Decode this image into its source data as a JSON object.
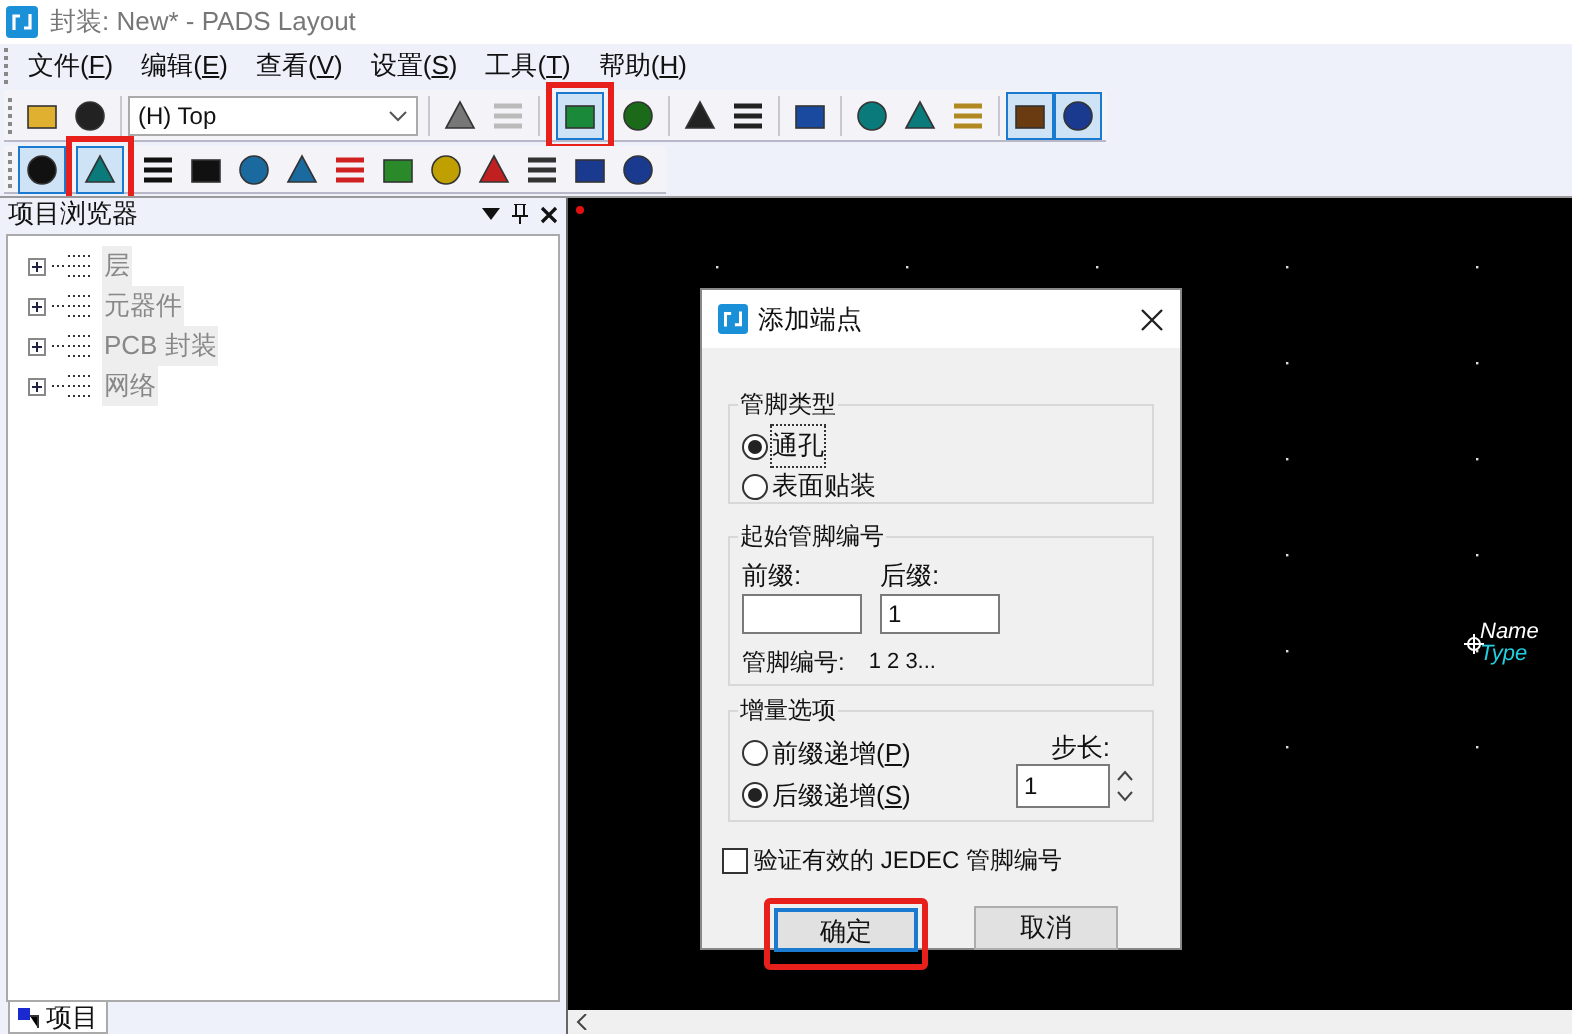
{
  "window": {
    "title": "封装: New* - PADS Layout"
  },
  "menu": [
    {
      "label": "文件",
      "hotkey": "(F)"
    },
    {
      "label": "编辑",
      "hotkey": "(E)"
    },
    {
      "label": "查看",
      "hotkey": "(V)"
    },
    {
      "label": "设置",
      "hotkey": "(S)"
    },
    {
      "label": "工具",
      "hotkey": "(T)"
    },
    {
      "label": "帮助",
      "hotkey": "(H)"
    }
  ],
  "layer_select": {
    "value": "(H) Top"
  },
  "toolbar_1": [
    {
      "pressed": false,
      "highlighted": false
    },
    {
      "pressed": false,
      "highlighted": false
    },
    {
      "pressed": false,
      "highlighted": false
    },
    {
      "pressed": false,
      "highlighted": false
    },
    {
      "pressed": true,
      "highlighted": true
    },
    {
      "pressed": false,
      "highlighted": false
    },
    {
      "pressed": false,
      "highlighted": false
    },
    {
      "pressed": false,
      "highlighted": false
    },
    {
      "pressed": false,
      "highlighted": false
    },
    {
      "pressed": false,
      "highlighted": false
    },
    {
      "pressed": false,
      "highlighted": false
    },
    {
      "pressed": false,
      "highlighted": false
    },
    {
      "pressed": true,
      "highlighted": false
    },
    {
      "pressed": true,
      "highlighted": false
    }
  ],
  "toolbar_2": [
    {
      "pressed": true,
      "highlighted": false
    },
    {
      "pressed": true,
      "highlighted": true
    },
    {
      "pressed": false,
      "highlighted": false
    },
    {
      "pressed": false,
      "highlighted": false
    },
    {
      "pressed": false,
      "highlighted": false
    },
    {
      "pressed": false,
      "highlighted": false
    },
    {
      "pressed": false,
      "highlighted": false
    },
    {
      "pressed": false,
      "highlighted": false
    },
    {
      "pressed": false,
      "highlighted": false
    },
    {
      "pressed": false,
      "highlighted": false
    },
    {
      "pressed": false,
      "highlighted": false
    },
    {
      "pressed": false,
      "highlighted": false
    },
    {
      "pressed": false,
      "highlighted": false
    }
  ],
  "project_browser": {
    "title": "项目浏览器",
    "items": [
      {
        "label": "层",
        "expanded": false
      },
      {
        "label": "元器件",
        "expanded": false
      },
      {
        "label": "PCB 封装",
        "expanded": false
      },
      {
        "label": "网络",
        "expanded": false
      }
    ],
    "tab": {
      "label": "项目",
      "selected": true
    }
  },
  "canvas": {
    "labels": [
      {
        "kind": "name",
        "text": "Name"
      },
      {
        "kind": "type",
        "text": "Type"
      }
    ]
  },
  "dialog": {
    "title": "添加端点",
    "pin_type": {
      "title": "管脚类型",
      "options": [
        {
          "label": "通孔",
          "selected": true
        },
        {
          "label": "表面贴装",
          "selected": false
        }
      ]
    },
    "start_number": {
      "title": "起始管脚编号",
      "prefix_label": "前缀:",
      "suffix_label": "后缀:",
      "suffix_value": "1",
      "preview_label": "管脚编号:",
      "preview_value": "1 2 3..."
    },
    "increment": {
      "title": "增量选项",
      "options": [
        {
          "label": "前缀递增",
          "hotkey": "(P)",
          "selected": false
        },
        {
          "label": "后缀递增",
          "hotkey": "(S)",
          "selected": true
        }
      ],
      "step_label": "步长:",
      "step_value": "1"
    },
    "verify": {
      "label": "验证有效的 JEDEC 管脚编号",
      "checked": false
    },
    "buttons": [
      {
        "label": "确定",
        "default": true,
        "highlighted": true
      },
      {
        "label": "取消",
        "default": false,
        "highlighted": false
      }
    ]
  }
}
